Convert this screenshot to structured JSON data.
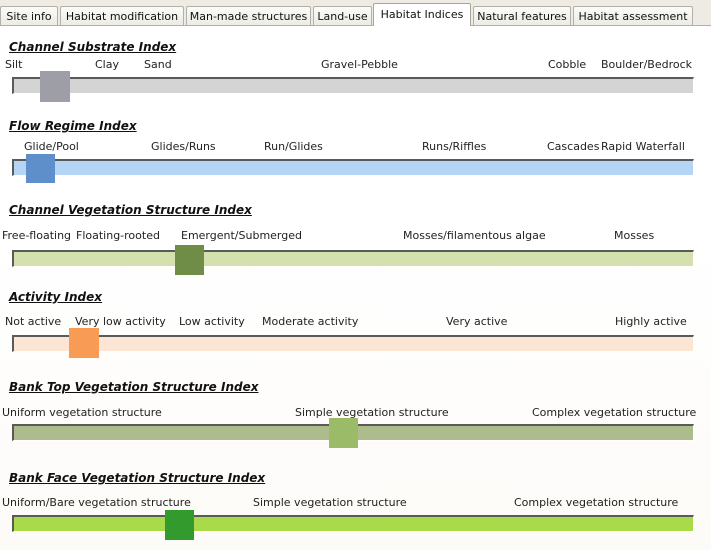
{
  "tabs": [
    {
      "label": "Site info",
      "active": false
    },
    {
      "label": "Habitat modification",
      "active": false
    },
    {
      "label": "Man-made structures",
      "active": false
    },
    {
      "label": "Land-use",
      "active": false
    },
    {
      "label": "Habitat Indices",
      "active": true
    },
    {
      "label": "Natural features",
      "active": false
    },
    {
      "label": "Habitat assessment",
      "active": false
    }
  ],
  "indices": [
    {
      "title": "Channel Substrate Index",
      "labels": [
        "Silt",
        "Clay",
        "Sand",
        "Gravel-Pebble",
        "Cobble",
        "Boulder/Bedrock"
      ],
      "track_color": "#d4d4d4",
      "thumb_color": "#9e9fa6",
      "value_pct": 4.3
    },
    {
      "title": "Flow Regime Index",
      "labels": [
        "Glide/Pool",
        "Glides/Runs",
        "Run/Glides",
        "Runs/Riffles",
        "Cascades",
        "Rapid Waterfall"
      ],
      "track_color": "#b5d5f7",
      "thumb_color": "#5f8fcb",
      "value_pct": 2.1
    },
    {
      "title": "Channel Vegetation Structure Index",
      "labels": [
        "Free-floating",
        "Floating-rooted",
        "Emergent/Submerged",
        "Mosses/filamentous algae",
        "Mosses"
      ],
      "track_color": "#d4e0ad",
      "thumb_color": "#6f8d46",
      "value_pct": 24.9
    },
    {
      "title": "Activity Index",
      "labels": [
        "Not active",
        "Very low activity",
        "Low activity",
        "Moderate activity",
        "Very active",
        "Highly active"
      ],
      "track_color": "#fde5d5",
      "thumb_color": "#f79b55",
      "value_pct": 8.7
    },
    {
      "title": "Bank Top Vegetation Structure Index",
      "labels": [
        "Uniform vegetation structure",
        "Simple vegetation structure",
        "Complex vegetation structure"
      ],
      "track_color": "#aebc8c",
      "thumb_color": "#9bbb68",
      "value_pct": 48.5
    },
    {
      "title": "Bank Face Vegetation Structure Index",
      "labels": [
        "Uniform/Bare vegetation structure",
        "Simple vegetation structure",
        "Complex vegetation structure"
      ],
      "track_color": "#a9da4a",
      "thumb_color": "#339a2e",
      "value_pct": 23.5
    }
  ]
}
